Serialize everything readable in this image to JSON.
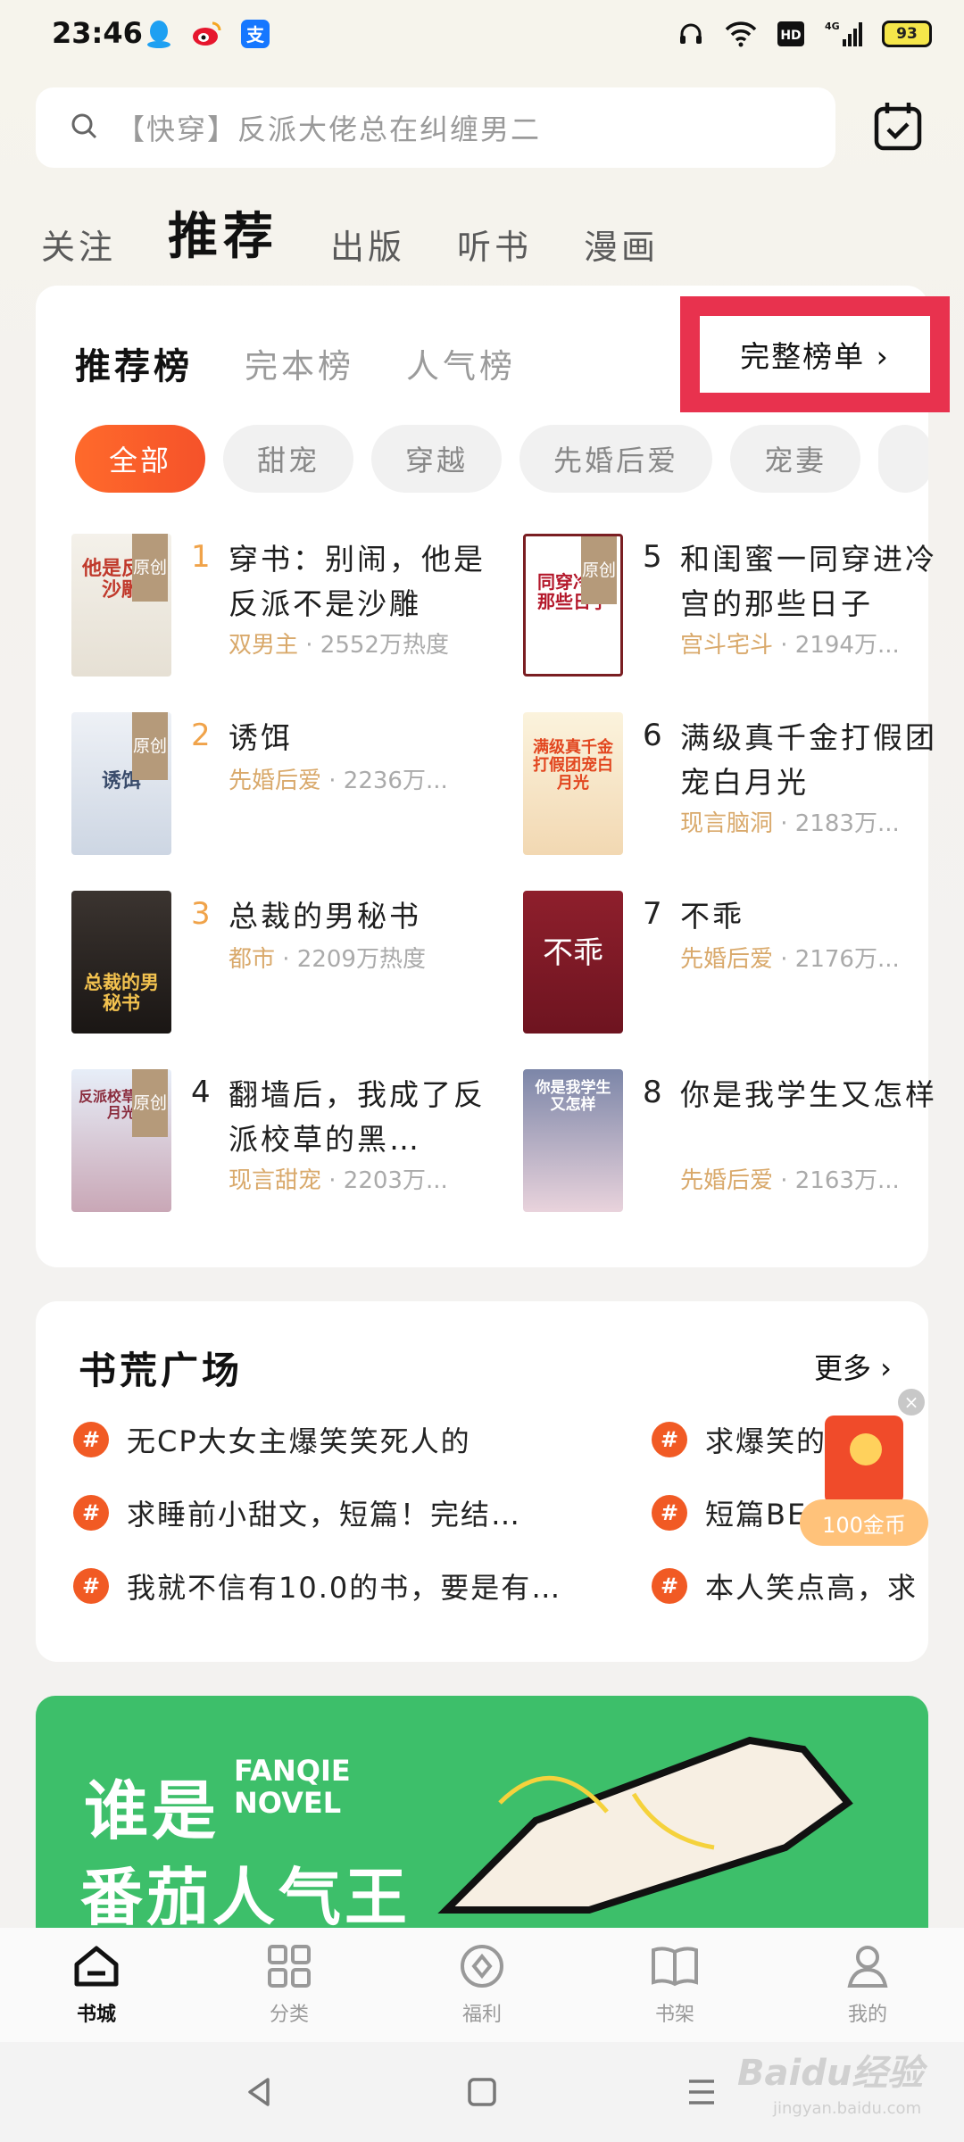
{
  "status_bar": {
    "time": "23:46",
    "battery": "93",
    "network": "4G",
    "hd": "HD",
    "left_icons": [
      "qq-icon",
      "weibo-icon",
      "alipay-icon"
    ],
    "right_icons": [
      "headphone-icon",
      "wifi-icon",
      "hd-icon",
      "signal-icon",
      "battery-icon"
    ]
  },
  "search": {
    "placeholder": "【快穿】反派大佬总在纠缠男二"
  },
  "top_tabs": [
    {
      "label": "关注",
      "active": false
    },
    {
      "label": "推荐",
      "active": true
    },
    {
      "label": "出版",
      "active": false
    },
    {
      "label": "听书",
      "active": false
    },
    {
      "label": "漫画",
      "active": false
    }
  ],
  "rank": {
    "tabs": [
      {
        "label": "推荐榜",
        "active": true
      },
      {
        "label": "完本榜",
        "active": false
      },
      {
        "label": "人气榜",
        "active": false
      }
    ],
    "full_list_label": "完整榜单 ›",
    "chips": [
      {
        "label": "全部",
        "active": true
      },
      {
        "label": "甜宠",
        "active": false
      },
      {
        "label": "穿越",
        "active": false
      },
      {
        "label": "先婚后爱",
        "active": false
      },
      {
        "label": "宠妻",
        "active": false
      }
    ],
    "badge_text": "原创",
    "books": [
      {
        "rank": "1",
        "title": "穿书：别闹，他是反派不是沙雕",
        "tag": "双男主",
        "heat": "· 2552万热度"
      },
      {
        "rank": "2",
        "title": "诱饵",
        "tag": "先婚后爱",
        "heat": "· 2236万..."
      },
      {
        "rank": "3",
        "title": "总裁的男秘书",
        "tag": "都市",
        "heat": "· 2209万热度"
      },
      {
        "rank": "4",
        "title": "翻墙后，我成了反派校草的黑…",
        "tag": "现言甜宠",
        "heat": "· 2203万..."
      },
      {
        "rank": "5",
        "title": "和闺蜜一同穿进冷宫的那些日子",
        "tag": "宫斗宅斗",
        "heat": "· 2194万..."
      },
      {
        "rank": "6",
        "title": "满级真千金打假团宠白月光",
        "tag": "现言脑洞",
        "heat": "· 2183万..."
      },
      {
        "rank": "7",
        "title": "不乖",
        "tag": "先婚后爱",
        "heat": "· 2176万..."
      },
      {
        "rank": "8",
        "title": "你是我学生又怎样",
        "tag": "先婚后爱",
        "heat": "· 2163万..."
      }
    ],
    "covers": {
      "c1": "他是反派沙雕",
      "c2": "诱饵",
      "c3": "总裁的男秘书",
      "c4": "反派校草的黑月光",
      "c5": "同穿冷宫那些日子",
      "c6": "满级真千金打假团宠白月光",
      "c7": "不乖",
      "c8": "你是我学生又怎样"
    }
  },
  "forum": {
    "title": "书荒广场",
    "more": "更多 ›",
    "hash": "#",
    "left_topics": [
      "无CP大女主爆笑笑死人的",
      "求睡前小甜文，短篇！完结…",
      "我就不信有10.0的书，要是有…"
    ],
    "right_topics": [
      "求爆笑的",
      "短篇BE",
      "本人笑点高，求"
    ]
  },
  "red_packet": {
    "label": "100金币",
    "close": "×"
  },
  "banner": {
    "line1": "谁是",
    "en1": "FANQIE",
    "en2": "NOVEL",
    "line2": "番茄人气王"
  },
  "bottom_nav": [
    {
      "label": "书城",
      "icon": "home-icon",
      "active": true
    },
    {
      "label": "分类",
      "icon": "grid-icon",
      "active": false
    },
    {
      "label": "福利",
      "icon": "gift-icon",
      "active": false
    },
    {
      "label": "书架",
      "icon": "book-icon",
      "active": false
    },
    {
      "label": "我的",
      "icon": "person-icon",
      "active": false
    }
  ],
  "watermark": {
    "main": "Baidu经验",
    "sub": "jingyan.baidu.com"
  },
  "colors": {
    "accent": "#f15a24",
    "highlight_border": "#e8324e",
    "meta_tag": "#d9a96b"
  }
}
